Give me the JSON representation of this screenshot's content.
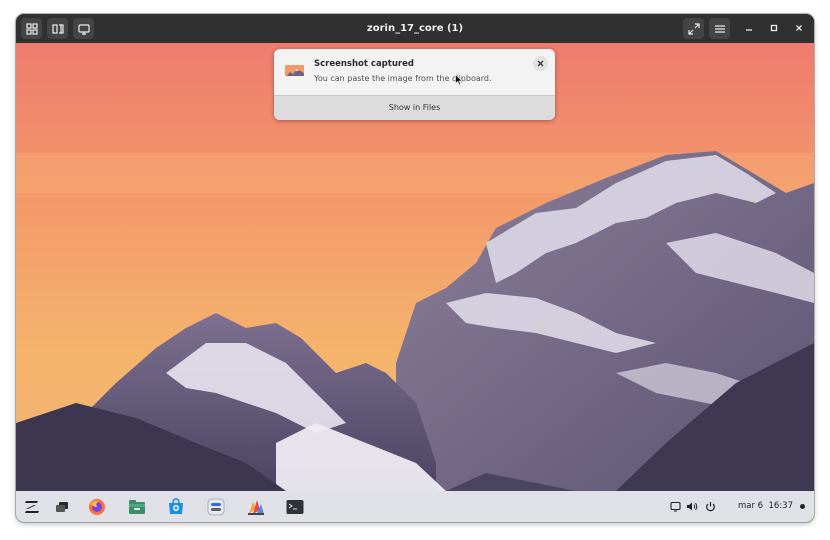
{
  "window": {
    "title": "zorin_17_core (1)"
  },
  "notification": {
    "title": "Screenshot captured",
    "body": "You can paste the image from the clipboard.",
    "action_label": "Show in Files"
  },
  "taskbar": {
    "apps": [
      "zorin-menu-icon",
      "workspaces-icon",
      "firefox-icon",
      "files-icon",
      "software-store-icon",
      "settings-icon",
      "drawing-app-icon",
      "terminal-icon"
    ],
    "clock": {
      "date": "mar 6",
      "time": "16:37"
    }
  },
  "colors": {
    "titlebar": "#303030",
    "taskbar": "#ebedf2",
    "sky_top": "#f07a6a",
    "sky_bottom": "#f3b26a"
  }
}
